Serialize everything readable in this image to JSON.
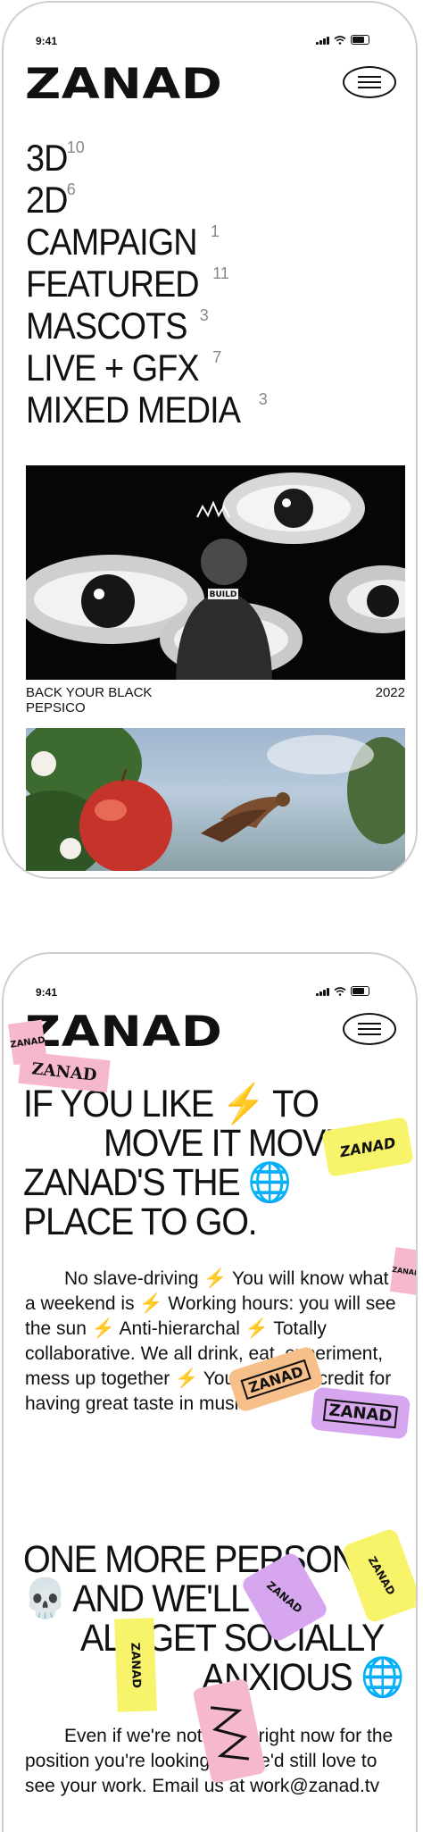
{
  "screen1": {
    "status_time": "9:41",
    "logo": "ZANAD",
    "categories": [
      {
        "label": "3D",
        "count": "10"
      },
      {
        "label": "2D",
        "count": "6"
      },
      {
        "label": "CAMPAIGN",
        "count": "1"
      },
      {
        "label": "FEATURED",
        "count": "11"
      },
      {
        "label": "MASCOTS",
        "count": "3"
      },
      {
        "label": "LIVE + GFX",
        "count": "7"
      },
      {
        "label": "MIXED MEDIA",
        "count": "3"
      }
    ],
    "project": {
      "title": "BACK YOUR BLACK",
      "client": "PEPSICO",
      "year": "2022",
      "shirt_text": "BUILD"
    }
  },
  "screen2": {
    "status_time": "9:41",
    "logo": "ZANAD",
    "headline_lines": [
      "IF YOU LIKE ⚡ TO",
      "MOVE IT MOVE IT",
      "ZANAD'S THE 🌐",
      "PLACE TO GO."
    ],
    "body": "No slave-driving ⚡ You will know what a weekend is ⚡ Working hours: you will see the sun ⚡ Anti-hierarchal ⚡ Totally collaborative. We all drink, eat, experiment, mess up together ⚡ You get extra credit for having great taste in music.",
    "headline2_lines": [
      "ONE MORE PERSON",
      "💀 AND WE'LL",
      "ALL GET SOCIALLY",
      "ANXIOUS 🌐"
    ],
    "body2": "Even if we're not hiring right now for the position you're looking for, we'd still love to see your work. Email us at work@zanad.tv",
    "stickers": [
      "ZANAD",
      "ZANAD",
      "ZANAD",
      "ZANAD",
      "ZANAD",
      "ZANAD",
      "ZANAD",
      "ZANAD",
      "ZANAD"
    ]
  },
  "colors": {
    "accent_yellow": "#f7f36a",
    "accent_pink": "#f6b8cf",
    "accent_orange": "#f7c08a",
    "accent_purple": "#d6a6ef"
  }
}
